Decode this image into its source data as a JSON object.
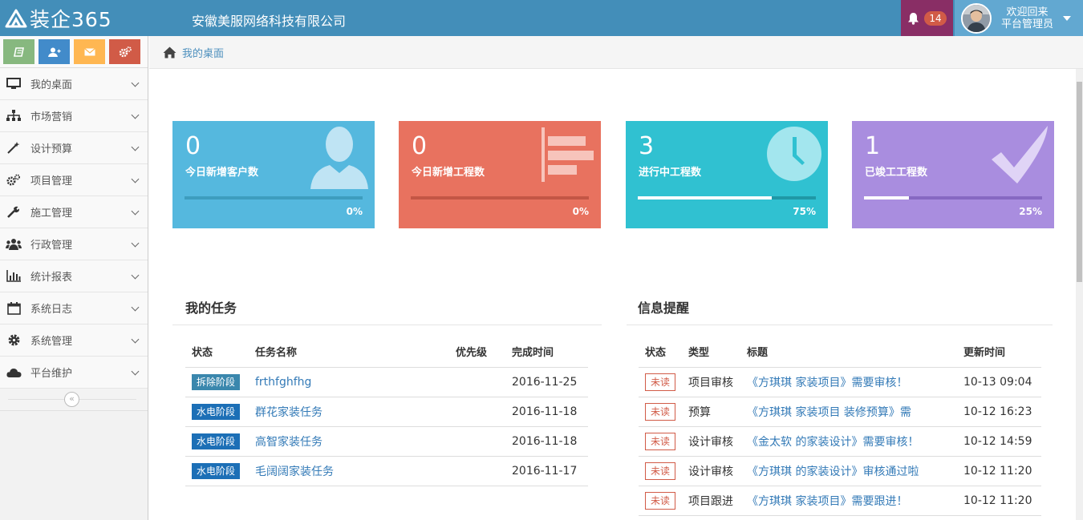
{
  "navbar": {
    "brand": "装企365",
    "company": "安徽美服网络科技有限公司",
    "notifications_count": "14",
    "welcome_line1": "欢迎回来",
    "welcome_line2": "平台管理员"
  },
  "colors": {
    "navbar": "#438eb9",
    "bell_bg": "#892e65",
    "user_bg": "#62a8d1",
    "card_blue": "#55b8de",
    "card_red": "#e8725f",
    "card_teal": "#30c1d1",
    "card_purple": "#a98ddf"
  },
  "shortcuts": [
    {
      "icon": "book-icon",
      "color": "#87b87f"
    },
    {
      "icon": "add-user-icon",
      "color": "#428bca"
    },
    {
      "icon": "envelope-icon",
      "color": "#ffb752"
    },
    {
      "icon": "cogs-icon",
      "color": "#d15b47"
    }
  ],
  "sidebar": {
    "items": [
      {
        "label": "我的桌面",
        "icon": "desktop-icon"
      },
      {
        "label": "市场营销",
        "icon": "sitemap-icon"
      },
      {
        "label": "设计预算",
        "icon": "magic-wand-icon"
      },
      {
        "label": "项目管理",
        "icon": "cogs-icon"
      },
      {
        "label": "施工管理",
        "icon": "wrench-icon"
      },
      {
        "label": "行政管理",
        "icon": "users-icon"
      },
      {
        "label": "统计报表",
        "icon": "bar-chart-icon"
      },
      {
        "label": "系统日志",
        "icon": "calendar-icon"
      },
      {
        "label": "系统管理",
        "icon": "gear-icon"
      },
      {
        "label": "平台维护",
        "icon": "cloud-icon"
      }
    ],
    "collapse": "«"
  },
  "breadcrumb": {
    "home": "我的桌面"
  },
  "stats": [
    {
      "value": "0",
      "label": "今日新增客户数",
      "percent": "0%",
      "progress": 0,
      "icon": "user-icon"
    },
    {
      "value": "0",
      "label": "今日新增工程数",
      "percent": "0%",
      "progress": 0,
      "icon": "align-left-icon"
    },
    {
      "value": "3",
      "label": "进行中工程数",
      "percent": "75%",
      "progress": 0.75,
      "icon": "clock-icon"
    },
    {
      "value": "1",
      "label": "已竣工工程数",
      "percent": "25%",
      "progress": 0.25,
      "icon": "check-icon"
    }
  ],
  "tasks": {
    "title": "我的任务",
    "headers": [
      "状态",
      "任务名称",
      "优先级",
      "完成时间"
    ],
    "rows": [
      {
        "stage": "拆除阶段",
        "stage_color": "#3a87ad",
        "name": "frthfghfhg",
        "priority": "",
        "date": "2016-11-25"
      },
      {
        "stage": "水电阶段",
        "stage_color": "#1c6fb6",
        "name": "群花家装任务",
        "priority": "",
        "date": "2016-11-18"
      },
      {
        "stage": "水电阶段",
        "stage_color": "#1c6fb6",
        "name": "高智家装任务",
        "priority": "",
        "date": "2016-11-18"
      },
      {
        "stage": "水电阶段",
        "stage_color": "#1c6fb6",
        "name": "毛阔阔家装任务",
        "priority": "",
        "date": "2016-11-17"
      }
    ]
  },
  "messages": {
    "title": "信息提醒",
    "headers": [
      "状态",
      "类型",
      "标题",
      "更新时间"
    ],
    "rows": [
      {
        "status": "未读",
        "type": "项目审核",
        "title": "《方琪琪 家装项目》需要审核！",
        "time": "10-13 09:04"
      },
      {
        "status": "未读",
        "type": "预算",
        "title": "《方琪琪 家装项目 装修预算》需",
        "time": "10-12 16:23"
      },
      {
        "status": "未读",
        "type": "设计审核",
        "title": "《金太软 的家装设计》需要审核！",
        "time": "10-12 14:59"
      },
      {
        "status": "未读",
        "type": "设计审核",
        "title": "《方琪琪 的家装设计》审核通过啦",
        "time": "10-12 11:20"
      },
      {
        "status": "未读",
        "type": "项目跟进",
        "title": "《方琪琪 家装项目》需要跟进！",
        "time": "10-12 11:20"
      }
    ]
  }
}
